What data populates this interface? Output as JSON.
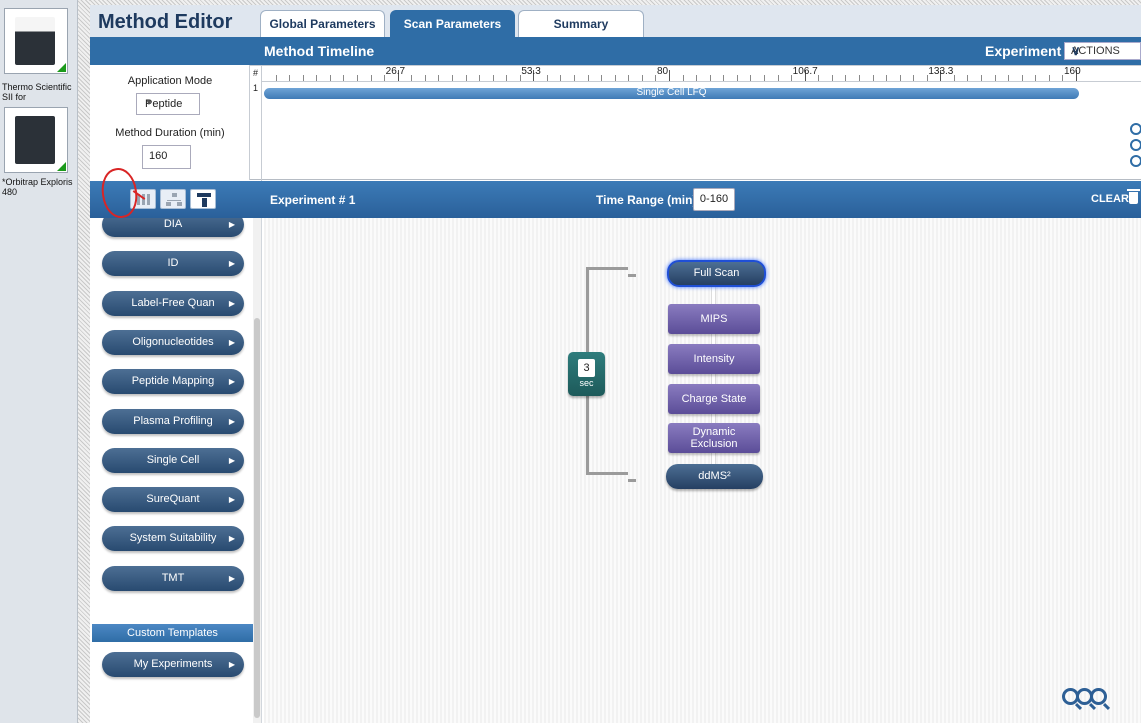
{
  "instruments": [
    {
      "name": "Thermo Scientific SII for"
    },
    {
      "name": "*Orbitrap Exploris 480"
    }
  ],
  "editor": {
    "title": "Method Editor",
    "tabs": [
      {
        "label": "Global Parameters"
      },
      {
        "label": "Scan Parameters"
      },
      {
        "label": "Summary"
      }
    ],
    "active_tab": "Scan Parameters"
  },
  "timeline": {
    "title": "Method Timeline",
    "experiment_label": "Experiment",
    "actions_label": "ACTIONS",
    "row_header": "#",
    "row_number": "1",
    "ticks": [
      "26.7",
      "53.3",
      "80",
      "106.7",
      "133.3",
      "160"
    ],
    "experiment_bar": "Single Cell LFQ"
  },
  "settings": {
    "app_mode_label": "Application Mode",
    "app_mode_value": "Peptide",
    "duration_label": "Method Duration (min)",
    "duration_value": "160"
  },
  "experiment": {
    "title": "Experiment # 1",
    "time_range_label": "Time Range (min)",
    "time_range_value": "0-160",
    "clear_label": "CLEAR"
  },
  "templates": {
    "items": [
      {
        "label": "DIA"
      },
      {
        "label": "ID"
      },
      {
        "label": "Label-Free Quan"
      },
      {
        "label": "Oligonucleotides"
      },
      {
        "label": "Peptide Mapping"
      },
      {
        "label": "Plasma Profiling"
      },
      {
        "label": "Single Cell"
      },
      {
        "label": "SureQuant"
      },
      {
        "label": "System Suitability"
      },
      {
        "label": "TMT"
      }
    ],
    "custom_header": "Custom Templates",
    "custom_items": [
      {
        "label": "My Experiments"
      }
    ]
  },
  "scan_tree": {
    "cycle_value": "3",
    "cycle_unit": "sec",
    "nodes": [
      {
        "label": "Full Scan"
      },
      {
        "label": "MIPS"
      },
      {
        "label": "Intensity"
      },
      {
        "label": "Charge State"
      },
      {
        "label": "Dynamic Exclusion"
      },
      {
        "label": "ddMS²"
      }
    ]
  },
  "colors": {
    "accent": "#2f6da6",
    "filter_node": "#6a5cab",
    "scan_node": "#2f4f75",
    "annotation": "#d92525"
  }
}
